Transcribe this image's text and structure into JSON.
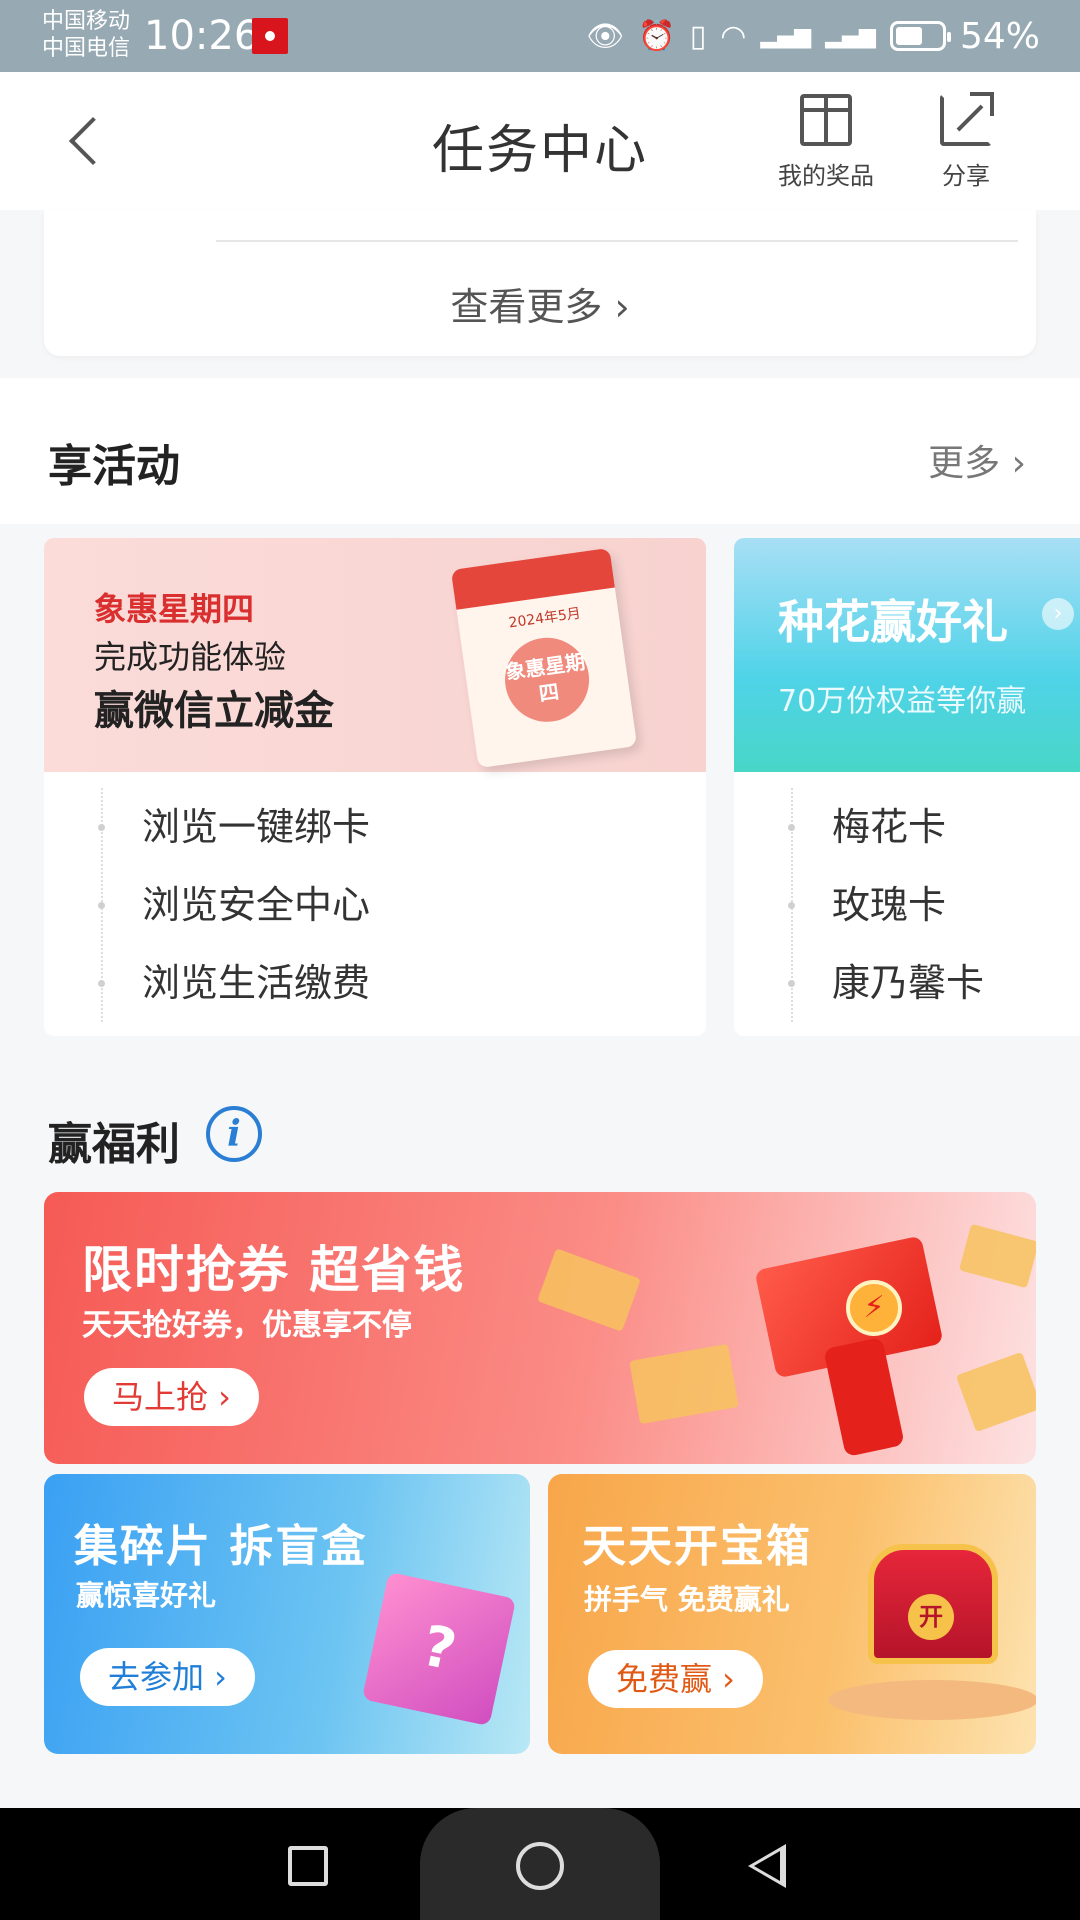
{
  "status_bar": {
    "carrier_1": "中国移动",
    "carrier_2": "中国电信",
    "time": "10:26",
    "battery": "54%",
    "icons": [
      "eye-icon",
      "alarm-icon",
      "vibrate-icon",
      "wifi-icon",
      "signal-4g-icon",
      "signal-4g-icon",
      "battery-icon"
    ]
  },
  "header": {
    "title": "任务中心",
    "my_prizes": "我的奖品",
    "share": "分享"
  },
  "top_card": {
    "see_more": "查看更多 ›"
  },
  "activities": {
    "title": "享活动",
    "more": "更多 ›",
    "cards": [
      {
        "tag": "象惠星期四",
        "line2": "完成功能体验",
        "line3": "赢微信立减金",
        "calendar_month": "2024年5月",
        "calendar_seal": "象惠星期四",
        "tasks": [
          "浏览一键绑卡",
          "浏览安全中心",
          "浏览生活缴费"
        ]
      },
      {
        "title": "种花赢好礼",
        "subtitle": "70万份权益等你赢",
        "tasks": [
          "梅花卡",
          "玫瑰卡",
          "康乃馨卡"
        ]
      }
    ]
  },
  "welfare": {
    "title": "赢福利",
    "big_promo": {
      "title": "限时抢券 超省钱",
      "subtitle": "天天抢好券，优惠享不停",
      "button": "马上抢 ›"
    },
    "left_promo": {
      "title": "集碎片 拆盲盒",
      "subtitle": "赢惊喜好礼",
      "button": "去参加 ›"
    },
    "right_promo": {
      "title": "天天开宝箱",
      "subtitle": "拼手气 免费赢礼",
      "button": "免费赢 ›"
    }
  },
  "colors": {
    "primary_red": "#f65a55",
    "blue": "#3aa0f3",
    "orange": "#f8a64a",
    "info_blue": "#2a7fd4"
  }
}
